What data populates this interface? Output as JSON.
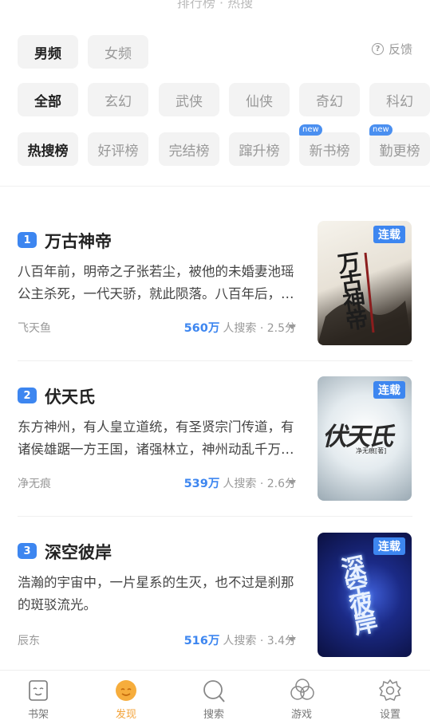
{
  "header": {
    "cut_text": "排行榜 · 热搜"
  },
  "gender_tabs": [
    {
      "label": "男频",
      "active": true
    },
    {
      "label": "女频",
      "active": false
    }
  ],
  "feedback": {
    "label": "反馈",
    "icon": "question-circle-icon"
  },
  "category_tabs": [
    {
      "label": "全部",
      "active": true
    },
    {
      "label": "玄幻",
      "active": false
    },
    {
      "label": "武侠",
      "active": false
    },
    {
      "label": "仙侠",
      "active": false
    },
    {
      "label": "奇幻",
      "active": false
    },
    {
      "label": "科幻",
      "active": false
    }
  ],
  "rank_tabs": [
    {
      "label": "热搜榜",
      "active": true,
      "new": false
    },
    {
      "label": "好评榜",
      "active": false,
      "new": false
    },
    {
      "label": "完结榜",
      "active": false,
      "new": false
    },
    {
      "label": "蹿升榜",
      "active": false,
      "new": false
    },
    {
      "label": "新书榜",
      "active": false,
      "new": true,
      "badge": "new"
    },
    {
      "label": "勤更榜",
      "active": false,
      "new": true,
      "badge": "new"
    }
  ],
  "books": [
    {
      "rank": "1",
      "title": "万古神帝",
      "description": "八百年前，明帝之子张若尘，被他的未婚妻池瑶公主杀死，一代天骄，就此陨落。八百年后，张若尘重新活了过来……",
      "author": "飞天鱼",
      "searches": "560万",
      "search_suffix": "人搜索 · 2.5分",
      "status": "连载",
      "cover_title": "万古神帝",
      "cover_colors": [
        "#f4f1ea",
        "#2b2b2b"
      ]
    },
    {
      "rank": "2",
      "title": "伏天氏",
      "description": "东方神州，有人皇立道统，有圣贤宗门传道，有诸侯雄踞一方王国，诸强林立，神州动乱千万载……",
      "author": "净无痕",
      "searches": "539万",
      "search_suffix": "人搜索 · 2.6分",
      "status": "连载",
      "cover_title": "伏天氏",
      "cover_author": "净无痕[著]",
      "cover_colors": [
        "#e6eef2",
        "#a7b4bd"
      ]
    },
    {
      "rank": "3",
      "title": "深空彼岸",
      "description": "浩瀚的宇宙中，一片星系的生灭，也不过是刹那的斑驳流光。",
      "author": "辰东",
      "searches": "516万",
      "search_suffix": "人搜索 · 3.4分",
      "status": "连载",
      "cover_title": "深空彼岸",
      "cover_colors": [
        "#1a2a7a",
        "#0c1238"
      ]
    }
  ],
  "tabbar": [
    {
      "label": "书架",
      "icon": "bookshelf-icon",
      "active": false
    },
    {
      "label": "发现",
      "icon": "discover-icon",
      "active": true
    },
    {
      "label": "搜索",
      "icon": "search-icon",
      "active": false
    },
    {
      "label": "游戏",
      "icon": "game-icon",
      "active": false
    },
    {
      "label": "设置",
      "icon": "gear-icon",
      "active": false
    }
  ],
  "colors": {
    "accent": "#3d86f0",
    "active_tab": "#f3a33a",
    "chip_bg": "#f3f3f3"
  }
}
